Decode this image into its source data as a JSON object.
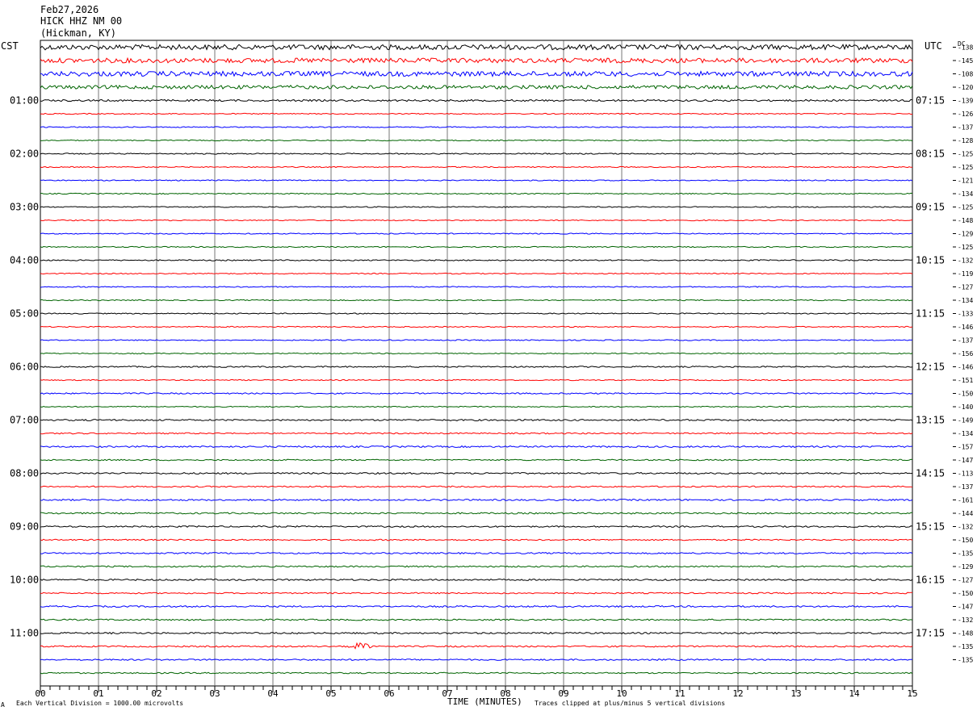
{
  "header": {
    "date": "Feb27,2026",
    "station": "HICK HHZ NM 00",
    "location": "(Hickman, KY)"
  },
  "labels": {
    "left_tz": "CST",
    "right_tz": "UTC",
    "dc": "DC"
  },
  "footer": {
    "scale_note": "Each Vertical Division = 1000.00 microvolts",
    "x_label": "TIME (MINUTES)",
    "clip_note": "Traces clipped at plus/minus 5 vertical divisions",
    "mark": "A"
  },
  "colors": {
    "trace_cycle": [
      "#000000",
      "#ff0000",
      "#0000ff",
      "#006400"
    ],
    "grid": "#000000"
  },
  "chart_data": {
    "type": "line",
    "title": "",
    "xlabel": "TIME (MINUTES)",
    "x_ticks": [
      "00",
      "01",
      "02",
      "03",
      "04",
      "05",
      "06",
      "07",
      "08",
      "09",
      "10",
      "11",
      "12",
      "13",
      "14",
      "15"
    ],
    "xlim": [
      0,
      15
    ],
    "n_traces": 48,
    "left_hour_labels": [
      {
        "trace": 4,
        "text": "01:00"
      },
      {
        "trace": 8,
        "text": "02:00"
      },
      {
        "trace": 12,
        "text": "03:00"
      },
      {
        "trace": 16,
        "text": "04:00"
      },
      {
        "trace": 20,
        "text": "05:00"
      },
      {
        "trace": 24,
        "text": "06:00"
      },
      {
        "trace": 28,
        "text": "07:00"
      },
      {
        "trace": 32,
        "text": "08:00"
      },
      {
        "trace": 36,
        "text": "09:00"
      },
      {
        "trace": 40,
        "text": "10:00"
      },
      {
        "trace": 44,
        "text": "11:00"
      }
    ],
    "right_hour_labels": [
      {
        "trace": 4,
        "text": "07:15"
      },
      {
        "trace": 8,
        "text": "08:15"
      },
      {
        "trace": 12,
        "text": "09:15"
      },
      {
        "trace": 16,
        "text": "10:15"
      },
      {
        "trace": 20,
        "text": "11:15"
      },
      {
        "trace": 24,
        "text": "12:15"
      },
      {
        "trace": 28,
        "text": "13:15"
      },
      {
        "trace": 32,
        "text": "14:15"
      },
      {
        "trace": 36,
        "text": "15:15"
      },
      {
        "trace": 40,
        "text": "16:15"
      },
      {
        "trace": 44,
        "text": "17:15"
      }
    ],
    "dc_offsets": [
      "-138",
      "-145",
      "-108",
      "-120",
      "-139",
      "-126",
      "-137",
      "-128",
      "-125",
      "-125",
      "-121",
      "-134",
      "-125",
      "-148",
      "-129",
      "-125",
      "-132",
      "-119",
      "-127",
      "-134",
      "-133",
      "-146",
      "-137",
      "-156",
      "-146",
      "-151",
      "-150",
      "-140",
      "-149",
      "-134",
      "-157",
      "-147",
      "-113",
      "-137",
      "-161",
      "-144",
      "-132",
      "-150",
      "-135",
      "-129",
      "-127",
      "-150",
      "-147",
      "-132",
      "-148",
      "-135",
      "-135"
    ],
    "trace_activity": [
      1.0,
      0.9,
      0.95,
      0.7,
      0.35,
      0.2,
      0.2,
      0.2,
      0.22,
      0.2,
      0.2,
      0.2,
      0.2,
      0.2,
      0.2,
      0.2,
      0.22,
      0.2,
      0.2,
      0.2,
      0.2,
      0.2,
      0.2,
      0.2,
      0.25,
      0.2,
      0.25,
      0.2,
      0.3,
      0.25,
      0.3,
      0.25,
      0.3,
      0.25,
      0.3,
      0.3,
      0.28,
      0.25,
      0.28,
      0.28,
      0.3,
      0.25,
      0.3,
      0.28,
      0.3,
      0.28,
      0.28,
      0.25
    ],
    "events": [
      {
        "trace": 45,
        "minute": 5.5,
        "amplitude": 0.9
      }
    ]
  }
}
